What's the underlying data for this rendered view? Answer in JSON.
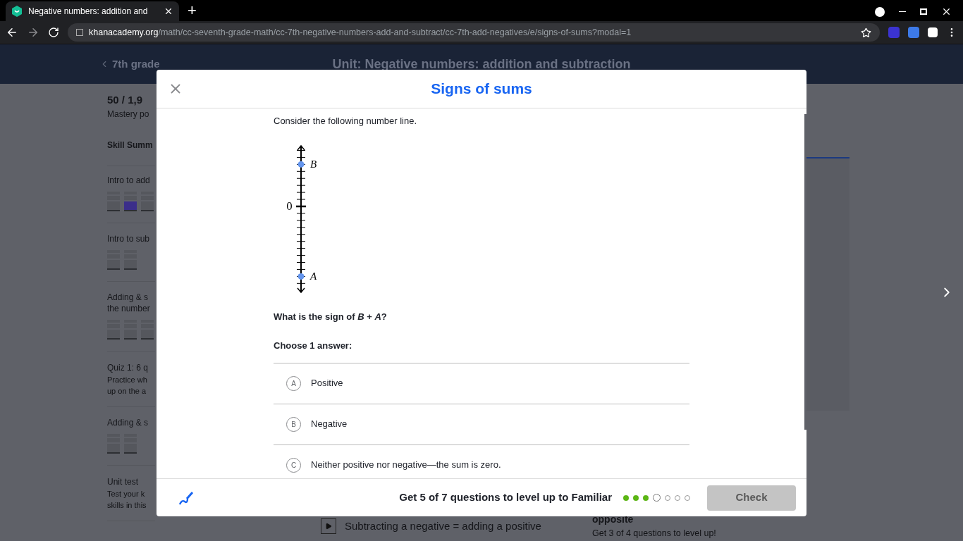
{
  "browser": {
    "tab_title": "Negative numbers: addition and",
    "new_tab": "+",
    "url_host": "khanacademy.org",
    "url_path": "/math/cc-seventh-grade-math/cc-7th-negative-numbers-add-and-subtract/cc-7th-add-negatives/e/signs-of-sums?modal=1"
  },
  "page": {
    "back_link": "7th grade",
    "unit_title": "Unit: Negative numbers: addition and subtraction",
    "sidebar": [
      {
        "kind": "score",
        "text": "50 / 1,9"
      },
      {
        "kind": "sub",
        "text": "Mastery po"
      },
      {
        "kind": "heading",
        "text": "Skill Summ"
      },
      {
        "kind": "skill",
        "text": "Intro to add",
        "bars": [
          {
            "mastered": false
          },
          {
            "mastered": true
          },
          {
            "mastered": false
          }
        ]
      },
      {
        "kind": "skill",
        "text": "Intro to sub",
        "bars": [
          {
            "mastered": false
          },
          {
            "mastered": false
          }
        ]
      },
      {
        "kind": "skill",
        "text": "Adding & s\nthe number",
        "bars": [
          {
            "mastered": false
          },
          {
            "mastered": false
          },
          {
            "mastered": false
          }
        ]
      },
      {
        "kind": "quiz",
        "text": "Quiz 1: 6 q",
        "sub": "Practice wh\nup on the a"
      },
      {
        "kind": "skill",
        "text": "Adding & s",
        "bars": [
          {
            "mastered": false
          },
          {
            "mastered": false
          }
        ]
      },
      {
        "kind": "quiz",
        "text": "Unit test",
        "sub": "Test your k\nskills in this"
      }
    ],
    "video_title": "Subtracting a negative = adding a positive",
    "card_title": "opposite",
    "card_sub": "Get 3 of 4 questions to level up!"
  },
  "modal": {
    "title": "Signs of sums",
    "intro": "Consider the following number line.",
    "number_line": {
      "zero_label": "0",
      "points": [
        {
          "label": "B"
        },
        {
          "label": "A"
        }
      ]
    },
    "question": "What is the sign of *B* + *A*?",
    "instruction": "Choose 1 answer:",
    "choices": [
      {
        "letter": "A",
        "text": "Positive",
        "selected": false
      },
      {
        "letter": "B",
        "text": "Negative",
        "selected": false
      },
      {
        "letter": "C",
        "text": "Neither positive nor negative—the sum is zero.",
        "selected": false
      }
    ],
    "footer": {
      "goal": "Get 5 of 7 questions to level up to Familiar",
      "dots": [
        {
          "done": true,
          "current": false
        },
        {
          "done": true,
          "current": false
        },
        {
          "done": true,
          "current": false
        },
        {
          "done": false,
          "current": true
        },
        {
          "done": false,
          "current": false
        },
        {
          "done": false,
          "current": false
        },
        {
          "done": false,
          "current": false
        }
      ],
      "check_button": "Check",
      "check_disabled": true
    }
  }
}
